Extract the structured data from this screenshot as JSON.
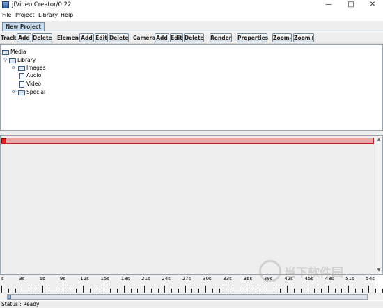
{
  "window": {
    "title": "jfVideo Creator/0.22"
  },
  "menu": {
    "items": [
      "File",
      "Project",
      "Library",
      "Help"
    ]
  },
  "tabs": [
    {
      "label": "New Project"
    }
  ],
  "toolbar": {
    "track_label": "Track:",
    "track_add": "Add",
    "track_delete": "Delete",
    "element_label": "Element:",
    "element_add": "Add",
    "element_edit": "Edit",
    "element_delete": "Delete",
    "camera_label": "Camera:",
    "camera_add": "Add",
    "camera_edit": "Edit",
    "camera_delete": "Delete",
    "render": "Render",
    "properties": "Properties",
    "zoom_out": "Zoom-",
    "zoom_in": "Zoom+"
  },
  "tree": {
    "root": "Media",
    "library": "Library",
    "images": "Images",
    "audio": "Audio",
    "video": "Video",
    "special": "Special"
  },
  "timeline": {
    "ticks": [
      "s",
      "3s",
      "6s",
      "9s",
      "12s",
      "15s",
      "18s",
      "21s",
      "24s",
      "27s",
      "30s",
      "33s",
      "36s",
      "39s",
      "42s",
      "45s",
      "48s",
      "51s",
      "54s"
    ]
  },
  "status": {
    "text": "Status : Ready"
  },
  "watermark": {
    "text": "当下软件园"
  }
}
